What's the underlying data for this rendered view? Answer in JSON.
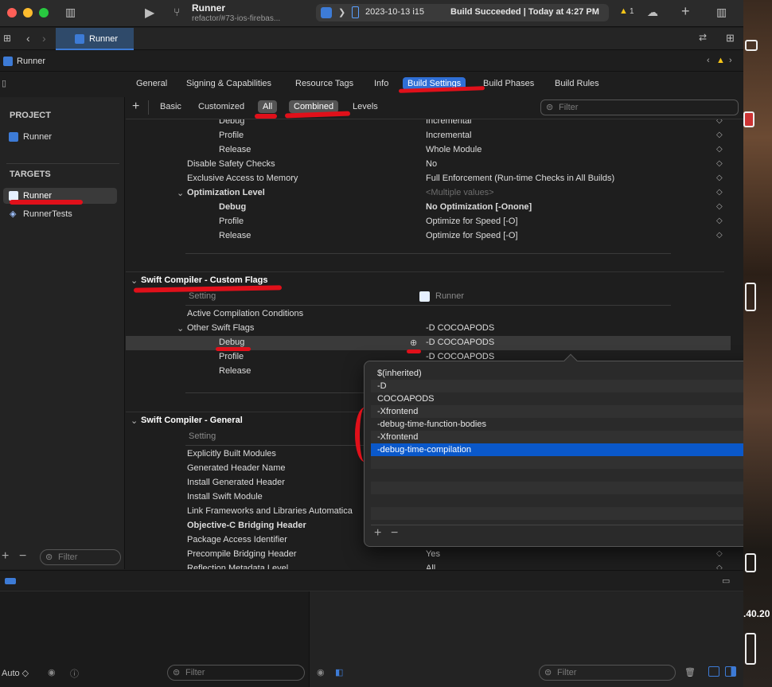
{
  "titlebar": {
    "project_name": "Runner",
    "branch": "refactor/#73-ios-firebas...",
    "destination": "2023-10-13 i15",
    "status": "Build Succeeded | Today at 4:27 PM",
    "warnings_count": "1"
  },
  "tabbar": {
    "tab_label": "Runner"
  },
  "jumpbar": {
    "path": "Runner"
  },
  "editor_tabs": [
    "General",
    "Signing & Capabilities",
    "Resource Tags",
    "Info",
    "Build Settings",
    "Build Phases",
    "Build Rules"
  ],
  "filter_chips": [
    "Basic",
    "Customized",
    "All",
    "Combined",
    "Levels"
  ],
  "search": {
    "placeholder": "Filter"
  },
  "sidebar": {
    "project_header": "PROJECT",
    "project_item": "Runner",
    "targets_header": "TARGETS",
    "targets": [
      "Runner",
      "RunnerTests"
    ],
    "filter_placeholder": "Filter"
  },
  "settings": {
    "rows_top": [
      {
        "name": "Debug",
        "value": "Incremental",
        "indent": 2,
        "bold": false
      },
      {
        "name": "Profile",
        "value": "Incremental",
        "indent": 2,
        "bold": false
      },
      {
        "name": "Release",
        "value": "Whole Module",
        "indent": 2,
        "bold": false
      },
      {
        "name": "Disable Safety Checks",
        "value": "No",
        "indent": 1,
        "bold": false
      },
      {
        "name": "Exclusive Access to Memory",
        "value": "Full Enforcement (Run-time Checks in All Builds)",
        "indent": 1,
        "bold": false
      },
      {
        "name": "Optimization Level",
        "value": "<Multiple values>",
        "indent": 1,
        "bold": true,
        "disclosure": true,
        "value_dim": true
      },
      {
        "name": "Debug",
        "value": "No Optimization [-Onone]",
        "indent": 2,
        "bold": true,
        "value_bold": true
      },
      {
        "name": "Profile",
        "value": "Optimize for Speed [-O]",
        "indent": 2,
        "bold": false
      },
      {
        "name": "Release",
        "value": "Optimize for Speed [-O]",
        "indent": 2,
        "bold": false
      }
    ],
    "section_custom_flags": "Swift Compiler - Custom Flags",
    "setting_col_header": "Setting",
    "target_col_header": "Runner",
    "custom_rows": [
      {
        "name": "Active Compilation Conditions",
        "value": "",
        "indent": 1
      },
      {
        "name": "Other Swift Flags",
        "value": "-D COCOAPODS",
        "indent": 1,
        "disclosure": true
      },
      {
        "name": "Debug",
        "value": "-D COCOAPODS",
        "indent": 2,
        "selected": true
      },
      {
        "name": "Profile",
        "value": "-D COCOAPODS",
        "indent": 2
      },
      {
        "name": "Release",
        "value": "",
        "indent": 2
      }
    ],
    "section_general": "Swift Compiler - General",
    "general_rows": [
      {
        "name": "Explicitly Built Modules",
        "value": "",
        "bold": false
      },
      {
        "name": "Generated Header Name",
        "value": "",
        "bold": false
      },
      {
        "name": "Install Generated Header",
        "value": "",
        "bold": false
      },
      {
        "name": "Install Swift Module",
        "value": "",
        "bold": false
      },
      {
        "name": "Link Frameworks and Libraries Automatica",
        "value": "",
        "bold": false
      },
      {
        "name": "Objective-C Bridging Header",
        "value": "",
        "bold": true
      },
      {
        "name": "Package Access Identifier",
        "value": "",
        "bold": false
      },
      {
        "name": "Precompile Bridging Header",
        "value": "Yes",
        "bold": false
      },
      {
        "name": "Reflection Metadata Level",
        "value": "All",
        "bold": false
      }
    ]
  },
  "popup": {
    "items": [
      "$(inherited)",
      "-D",
      "COCOAPODS",
      "-Xfrontend",
      "-debug-time-function-bodies",
      "-Xfrontend",
      "-debug-time-compilation"
    ],
    "selected_index": 6
  },
  "debug_area": {
    "auto_label": "Auto ◇",
    "left_filter": "Filter",
    "right_filter": "Filter"
  },
  "desktop": {
    "fragment": ".40.20"
  },
  "colors": {
    "accent": "#2f6fd6",
    "selection": "#0a58ca",
    "annotation": "#e0101a"
  }
}
